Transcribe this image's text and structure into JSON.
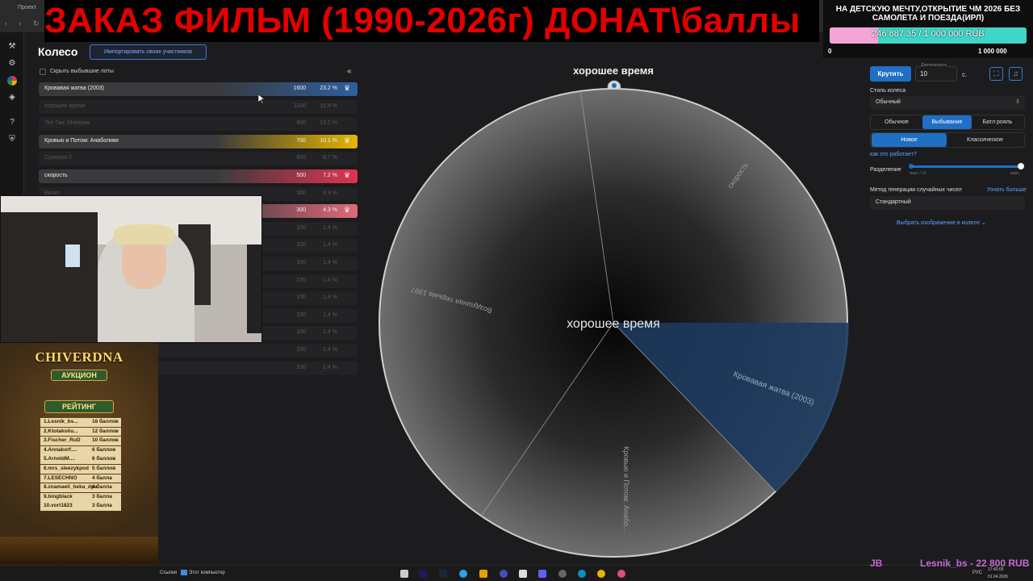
{
  "browser": {
    "tab_label": "Проект"
  },
  "overlay": {
    "banner": "ЗАКАЗ ФИЛЬМ (1990-2026г) ДОНАТ\\баллы",
    "donation_user": "Lesnik_bs - 22 800 RUB",
    "jb": "JB"
  },
  "goal": {
    "title": "НА ДЕТСКУЮ МЕЧТУ,ОТКРЫТИЕ ЧМ 2026 БЕЗ САМОЛЕТА И ПОЕЗДА(ИРЛ)",
    "amount": "246 887.35 / 1 000 000 RUB",
    "progress": 0.2469,
    "min": "0",
    "max": "1 000 000",
    "bar_color": "#3dd6c8",
    "fill_color": "#f3a6d6"
  },
  "page": {
    "title": "Колесо",
    "import_button": "Импортировать своих участников",
    "hide_label": "Скрыть выбывшие лоты",
    "collapse_icon": "«"
  },
  "lots": [
    {
      "name": "Кровавая жатва (2003)",
      "amount": "1600",
      "pct": "23.2 %",
      "active": true,
      "color": "#2d5fa0"
    },
    {
      "name": "хорошее время",
      "amount": "1100",
      "pct": "15.9 %",
      "active": false
    },
    {
      "name": "Топ Ган: Мэверик",
      "amount": "900",
      "pct": "13.0 %",
      "active": false
    },
    {
      "name": "Кровью и Потом: Анаболики",
      "amount": "700",
      "pct": "10.1 %",
      "active": true,
      "color": "#e6b400"
    },
    {
      "name": "Сумерки 2",
      "amount": "600",
      "pct": "8.7 %",
      "active": false
    },
    {
      "name": "скорость",
      "amount": "500",
      "pct": "7.2 %",
      "active": true,
      "color": "#e0344f"
    },
    {
      "name": "Визит",
      "amount": "300",
      "pct": "4.3 %",
      "active": false
    },
    {
      "name": "",
      "amount": "300",
      "pct": "4.3 %",
      "active": true,
      "color": "#e06a7a"
    },
    {
      "name": "",
      "amount": "100",
      "pct": "1.4 %",
      "active": false
    },
    {
      "name": "",
      "amount": "100",
      "pct": "1.4 %",
      "active": false
    },
    {
      "name": "",
      "amount": "100",
      "pct": "1.4 %",
      "active": false
    },
    {
      "name": "",
      "amount": "100",
      "pct": "1.4 %",
      "active": false
    },
    {
      "name": "",
      "amount": "100",
      "pct": "1.4 %",
      "active": false
    },
    {
      "name": "",
      "amount": "100",
      "pct": "1.4 %",
      "active": false
    },
    {
      "name": "",
      "amount": "100",
      "pct": "1.4 %",
      "active": false
    },
    {
      "name": "",
      "amount": "100",
      "pct": "1.4 %",
      "active": false
    },
    {
      "name": "",
      "amount": "100",
      "pct": "1.4 %",
      "active": false
    }
  ],
  "rating": {
    "title": "CHIVERDNA",
    "subtitle": "АУКЦИОН",
    "header": "РЕЙТИНГ",
    "entries": [
      {
        "name": "1.Lesnik_bs...",
        "points": "16 баллов"
      },
      {
        "name": "2.Ktotakoiiu...",
        "points": "12 баллов"
      },
      {
        "name": "3.Fischer_RuD",
        "points": "10 баллов"
      },
      {
        "name": "4.Annakorf....",
        "points": "6 баллов"
      },
      {
        "name": "5.ArnoldM....",
        "points": "6 баллов"
      },
      {
        "name": "6.mrs_sleezykpod",
        "points": "5 баллов"
      },
      {
        "name": "7.LESECHNO",
        "points": "4 балла"
      },
      {
        "name": "8.znamaeli_heka_dpa",
        "points": "4 балла"
      },
      {
        "name": "9.bingblack",
        "points": "3 балла"
      },
      {
        "name": "10.vort1823",
        "points": "3 балла"
      }
    ]
  },
  "wheel": {
    "current_label": "хорошее время",
    "center_label": "хорошее время",
    "segment_labels": [
      "скорость",
      "Воздушная тюрьма 1997",
      "Кровью и Потом: Анабо...",
      "Кровавая жатва (2003)"
    ],
    "highlight_color": "#1d3a5f"
  },
  "controls": {
    "spin": "Крутить",
    "duration_label": "Длительность",
    "duration_value": "10",
    "duration_unit": "с.",
    "wheel_style_label": "Стиль колеса",
    "wheel_style_value": "Обычный",
    "modes": [
      "Обычное",
      "Выбывание",
      "Батл рояль"
    ],
    "active_mode": "Выбывание",
    "variants": [
      "Новое",
      "Классическое"
    ],
    "active_variant": "Новое",
    "how_link": "как это работает?",
    "split_label": "Разделение",
    "split_min": "макс / 10",
    "split_max": "макс",
    "split_value": 1.0,
    "rng_label": "Метод генерации случайных чисел",
    "rng_link": "Узнать больше",
    "rng_value": "Стандартный",
    "image_link": "Выбрать изображение в колесе"
  },
  "taskbar": {
    "links": "Ссылки",
    "computer": "Этот компьютер",
    "lang": "РУС",
    "time": "17:42:03",
    "date": "01.04.2026"
  }
}
